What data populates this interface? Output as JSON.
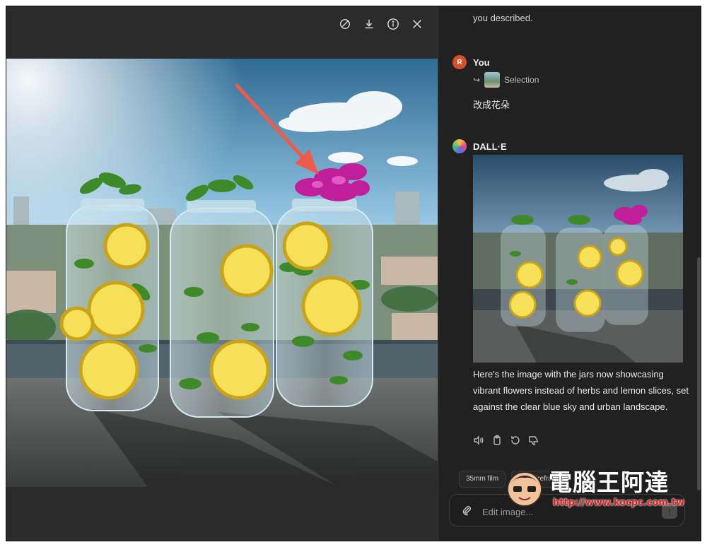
{
  "viewer": {
    "toolbar": [
      {
        "name": "edit-brush-icon"
      },
      {
        "name": "download-icon"
      },
      {
        "name": "info-icon"
      },
      {
        "name": "close-icon"
      }
    ]
  },
  "chat": {
    "previous_text": "you described.",
    "user": {
      "avatar_letter": "R",
      "name": "You",
      "selection_label": "Selection",
      "message": "改成花朵",
      "avatar_color": "#d94f2b"
    },
    "assistant": {
      "name": "DALL·E",
      "reply": "Here's the image with the jars now showcasing vibrant flowers instead of herbs and lemon slices, set against the clear blue sky and urban landscape.",
      "actions": [
        "speaker-icon",
        "copy-icon",
        "regenerate-icon",
        "thumbs-down-icon"
      ]
    },
    "chips": [
      "35mm film",
      "3D Wireframe"
    ],
    "composer": {
      "placeholder": "Edit image...",
      "send_label": "↑"
    }
  },
  "watermark": {
    "title": "電腦王阿達",
    "url": "http://www.kocpc.com.tw"
  },
  "colors": {
    "background": "#212121",
    "viewer": "#2b2b2b",
    "annotation_arrow": "#ef5a4c",
    "flower": "#c01e9a"
  }
}
